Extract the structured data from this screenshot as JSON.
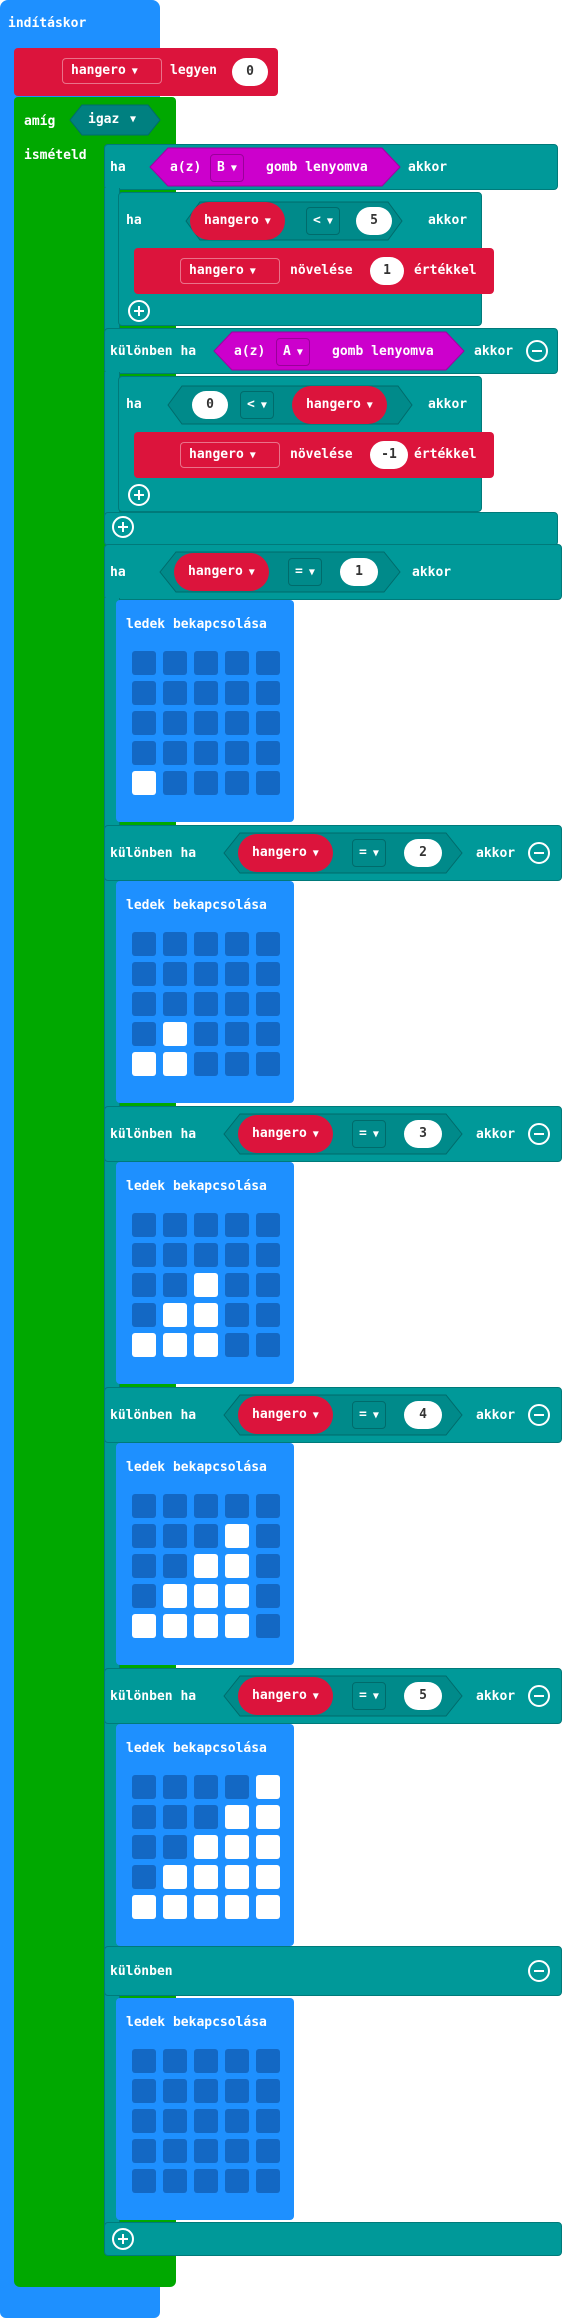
{
  "labels": {
    "on_start": "indításkor",
    "set_to": "legyen",
    "while": "amíg",
    "do": "ismételd",
    "if": "ha",
    "then": "akkor",
    "else_if": "különben ha",
    "else": "különben",
    "button_prefix": "a(z)",
    "button_pressed": "gomb lenyomva",
    "change_by": "növelése",
    "value_suffix": "értékkel",
    "show_leds": "ledek bekapcsolása"
  },
  "variable": "hangero",
  "initial_value": "0",
  "while_condition": "igaz",
  "button_b": "B",
  "button_a": "A",
  "op_lt": "<",
  "op_eq": "=",
  "limit_high": "5",
  "limit_low": "0",
  "step_up": "1",
  "step_down": "-1",
  "compare_values": [
    "1",
    "2",
    "3",
    "4",
    "5"
  ],
  "led_patterns": [
    [
      [
        0,
        0,
        0,
        0,
        0
      ],
      [
        0,
        0,
        0,
        0,
        0
      ],
      [
        0,
        0,
        0,
        0,
        0
      ],
      [
        0,
        0,
        0,
        0,
        0
      ],
      [
        1,
        0,
        0,
        0,
        0
      ]
    ],
    [
      [
        0,
        0,
        0,
        0,
        0
      ],
      [
        0,
        0,
        0,
        0,
        0
      ],
      [
        0,
        0,
        0,
        0,
        0
      ],
      [
        0,
        1,
        0,
        0,
        0
      ],
      [
        1,
        1,
        0,
        0,
        0
      ]
    ],
    [
      [
        0,
        0,
        0,
        0,
        0
      ],
      [
        0,
        0,
        0,
        0,
        0
      ],
      [
        0,
        0,
        1,
        0,
        0
      ],
      [
        0,
        1,
        1,
        0,
        0
      ],
      [
        1,
        1,
        1,
        0,
        0
      ]
    ],
    [
      [
        0,
        0,
        0,
        0,
        0
      ],
      [
        0,
        0,
        0,
        1,
        0
      ],
      [
        0,
        0,
        1,
        1,
        0
      ],
      [
        0,
        1,
        1,
        1,
        0
      ],
      [
        1,
        1,
        1,
        1,
        0
      ]
    ],
    [
      [
        0,
        0,
        0,
        0,
        1
      ],
      [
        0,
        0,
        0,
        1,
        1
      ],
      [
        0,
        0,
        1,
        1,
        1
      ],
      [
        0,
        1,
        1,
        1,
        1
      ],
      [
        1,
        1,
        1,
        1,
        1
      ]
    ],
    [
      [
        0,
        0,
        0,
        0,
        0
      ],
      [
        0,
        0,
        0,
        0,
        0
      ],
      [
        0,
        0,
        0,
        0,
        0
      ],
      [
        0,
        0,
        0,
        0,
        0
      ],
      [
        0,
        0,
        0,
        0,
        0
      ]
    ]
  ],
  "colors": {
    "basic": "#1e90ff",
    "loops": "#00a800",
    "logic": "#009999",
    "variables": "#dc143c",
    "input": "#cc00cc",
    "led_on": "#ffffff",
    "led_off": "#1368c4"
  }
}
